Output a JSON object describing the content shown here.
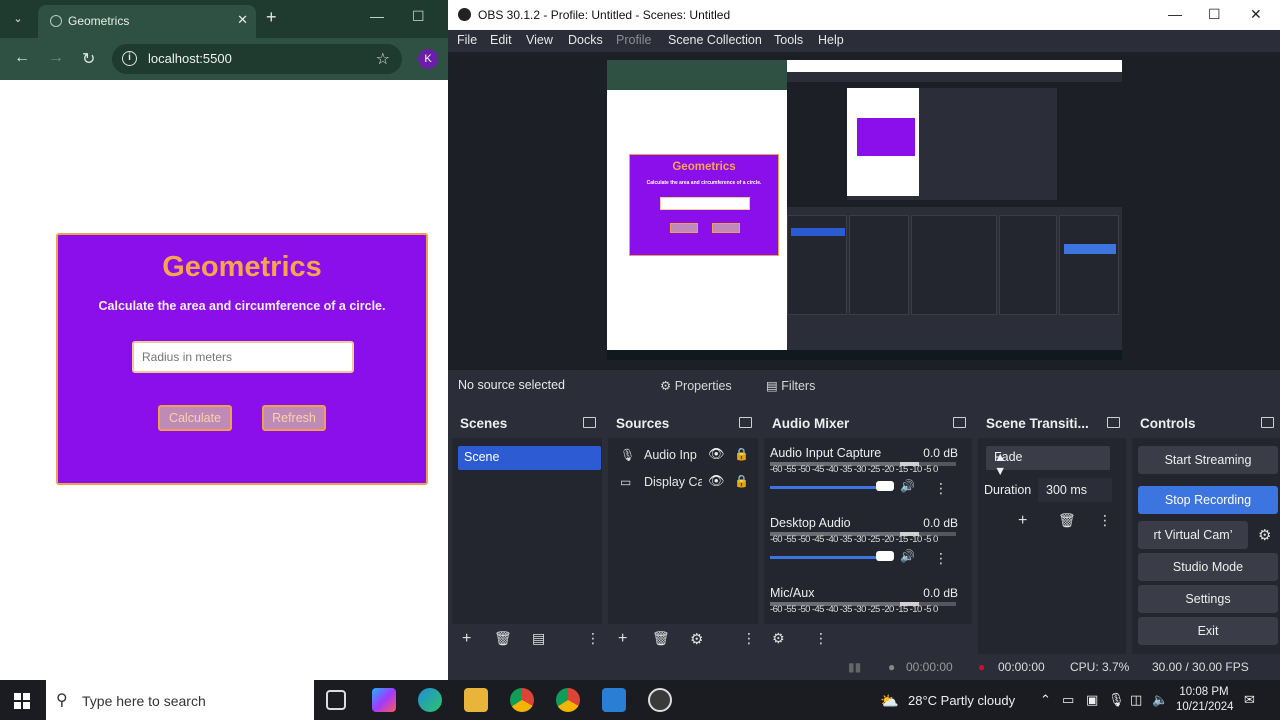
{
  "browser": {
    "tab_title": "Geometrics",
    "url": "localhost:5500",
    "avatar": "K",
    "page": {
      "title": "Geometrics",
      "subtitle": "Calculate the area and circumference of a circle.",
      "input_placeholder": "Radius in meters",
      "calculate_label": "Calculate",
      "refresh_label": "Refresh"
    }
  },
  "obs": {
    "title": "OBS 30.1.2 - Profile: Untitled - Scenes: Untitled",
    "menu": [
      "File",
      "Edit",
      "View",
      "Docks",
      "Profile",
      "Scene Collection",
      "Tools",
      "Help"
    ],
    "source_bar": {
      "status": "No source selected",
      "properties": "Properties",
      "filters": "Filters"
    },
    "preview": {
      "page_title": "Geometrics",
      "page_subtitle": "Calculate the area and circumference of a circle."
    },
    "scenes": {
      "title": "Scenes",
      "items": [
        "Scene"
      ]
    },
    "sources": {
      "title": "Sources",
      "items": [
        {
          "label": "Audio Inp"
        },
        {
          "label": "Display Ca"
        }
      ]
    },
    "mixer": {
      "title": "Audio Mixer",
      "scale": "-60 -55 -50 -45 -40 -35 -30 -25 -20 -15 -10 -5 0",
      "channels": [
        {
          "name": "Audio Input Capture",
          "db": "0.0 dB"
        },
        {
          "name": "Desktop Audio",
          "db": "0.0 dB"
        },
        {
          "name": "Mic/Aux",
          "db": "0.0 dB"
        }
      ]
    },
    "transitions": {
      "title": "Scene Transiti...",
      "selected": "Fade",
      "duration_label": "Duration",
      "duration_value": "300 ms"
    },
    "controls": {
      "title": "Controls",
      "start_streaming": "Start Streaming",
      "stop_recording": "Stop Recording",
      "virtual_cam": "rt Virtual Cam’",
      "studio_mode": "Studio Mode",
      "settings": "Settings",
      "exit": "Exit"
    },
    "status": {
      "stream_time": "00:00:00",
      "rec_time": "00:00:00",
      "cpu": "CPU: 3.7%",
      "fps": "30.00 / 30.00 FPS"
    }
  },
  "taskbar": {
    "search_placeholder": "Type here to search",
    "weather": "28°C  Partly cloudy",
    "time": "10:08 PM",
    "date": "10/21/2024"
  },
  "colors": {
    "accent_purple": "#8a0fea",
    "title_orange": "#f7a44d",
    "obs_blue": "#3c74e0",
    "rec_red": "#c8102e"
  }
}
